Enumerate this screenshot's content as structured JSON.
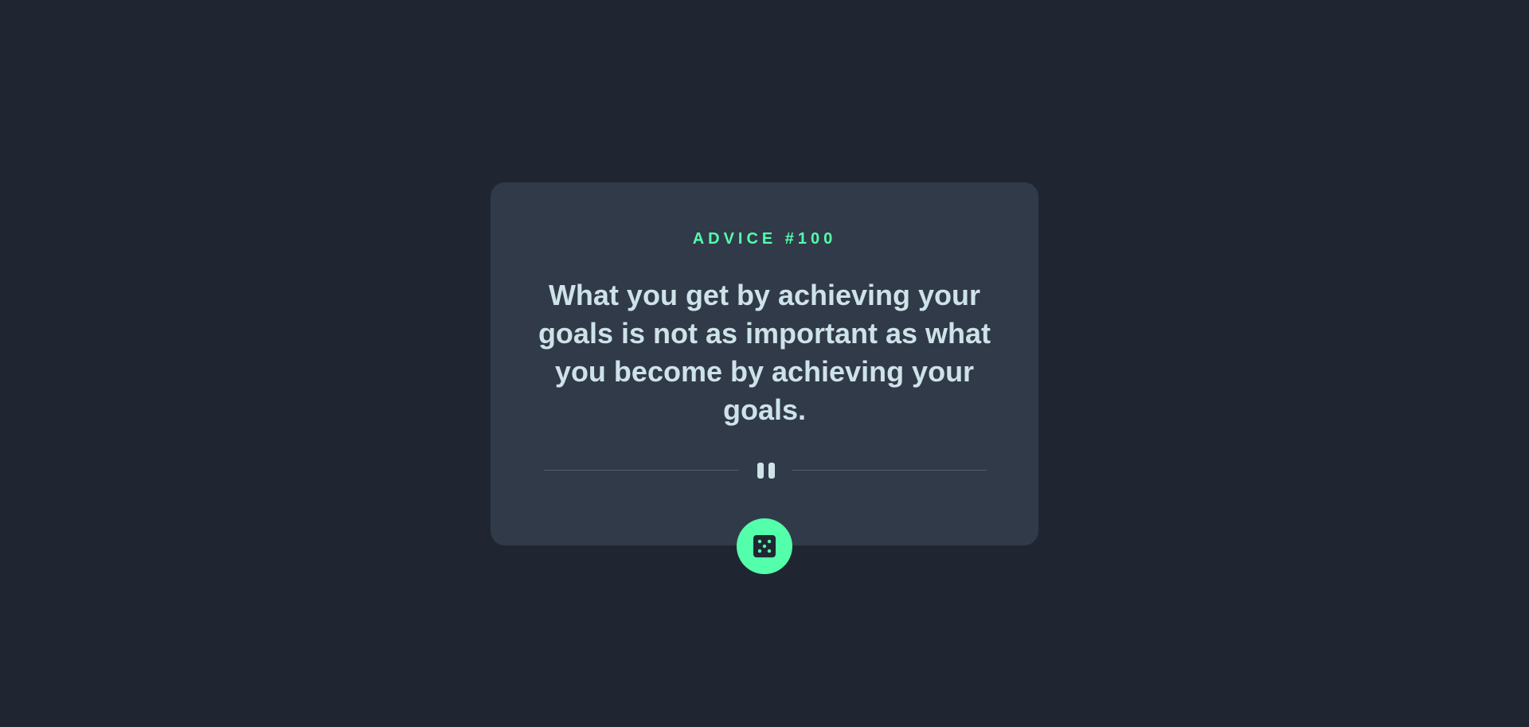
{
  "advice": {
    "id_label": "ADVICE #100",
    "text": "What you get by achieving your goals is not as important as what you become by achieving your goals."
  },
  "divider": {
    "icon": "pause-icon"
  },
  "dice_button": {
    "icon": "dice-icon"
  },
  "colors": {
    "background": "#1f2632",
    "card": "#313a48",
    "accent": "#53ffaa",
    "text": "#cee3e9",
    "divider": "#4f5d74"
  }
}
